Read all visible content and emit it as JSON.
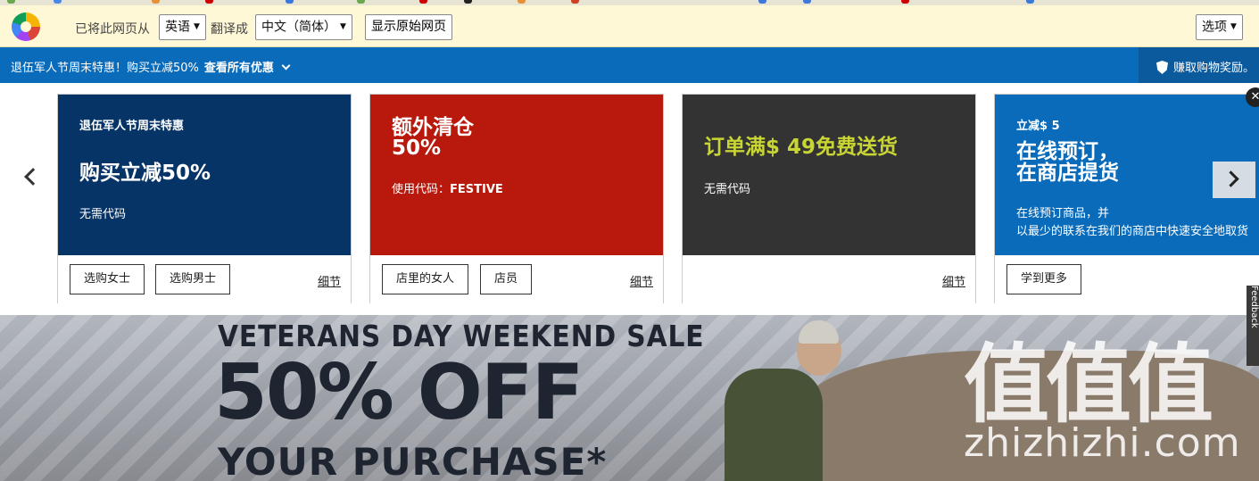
{
  "translate_bar": {
    "from_text": "已将此网页从",
    "source_lang": "英语",
    "to_text": "翻译成",
    "target_lang": "中文（简体）",
    "show_original": "显示原始网页",
    "options": "选项"
  },
  "promo_bar": {
    "message": "退伍军人节周末特惠！购买立减50%",
    "view_all": "查看所有优惠",
    "reward": "赚取购物奖励。"
  },
  "offers": [
    {
      "color": "#063467",
      "eyebrow": "退伍军人节周末特惠",
      "headline": "购买立减50%",
      "note": "无需代码",
      "buttons": [
        "选购女士",
        "选购男士"
      ],
      "details": "细节"
    },
    {
      "color": "#b8190c",
      "headline_line1": "额外清仓",
      "headline_line2": "50%",
      "code_label": "使用代码：",
      "code": "FESTIVE",
      "buttons": [
        "店里的女人",
        "店员"
      ],
      "details": "细节"
    },
    {
      "color": "#333333",
      "headline": "订单满$ 49免费送货",
      "headline_color": "#c8d534",
      "note": "无需代码",
      "details": "细节"
    },
    {
      "color": "#0a6bbb",
      "eyebrow": "立减$ 5",
      "headline_line1": "在线预订，",
      "headline_line2": "在商店提货",
      "note_line1": "在线预订商品，并",
      "note_line2": "以最少的联系在我们的商店中快速安全地取货",
      "buttons": [
        "学到更多"
      ]
    }
  ],
  "feedback": "Feedback",
  "hero": {
    "line1": "VETERANS DAY WEEKEND SALE",
    "line2": "50% OFF",
    "line3": "YOUR PURCHASE*",
    "watermark_big": "值值值",
    "watermark_small": "zhizhizhi.com"
  }
}
